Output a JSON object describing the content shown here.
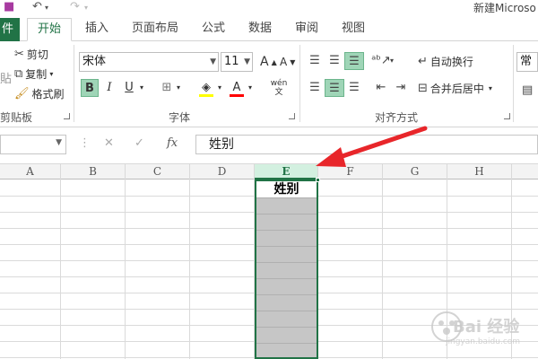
{
  "window": {
    "title": "新建Microso"
  },
  "tabs": {
    "file": "件",
    "items": [
      "开始",
      "插入",
      "页面布局",
      "公式",
      "数据",
      "审阅",
      "视图"
    ],
    "active": "开始"
  },
  "clipboard": {
    "cut": "剪切",
    "copy": "复制",
    "format_painter": "格式刷",
    "group_label": "剪贴板"
  },
  "font": {
    "name": "宋体",
    "size": "11",
    "bold": "B",
    "italic": "I",
    "underline": "U",
    "phonetic": "wén",
    "group_label": "字体"
  },
  "alignment": {
    "wrap_text": "自动换行",
    "merge_center": "合并后居中",
    "group_label": "对齐方式"
  },
  "number": {
    "format": "常规"
  },
  "formula_bar": {
    "fx": "fx",
    "value": "姓别"
  },
  "columns": [
    "A",
    "B",
    "C",
    "D",
    "E",
    "F",
    "G",
    "H"
  ],
  "selected_column": "E",
  "cells": {
    "E1": "姓别"
  },
  "colors": {
    "accent": "#217346",
    "selection_fill": "#c6c6c6",
    "header_selected": "#d3f0e0",
    "arrow": "#e8262a",
    "highlight_yellow": "#ffff00",
    "font_red": "#ff0000"
  },
  "icons": [
    "undo-icon",
    "redo-icon",
    "scissors-icon",
    "copy-icon",
    "paintbrush-icon",
    "bucket-icon",
    "font-color-icon",
    "borders-icon",
    "cancel-icon",
    "enter-icon"
  ],
  "watermark": {
    "text": "Bai 经验",
    "sub": "jingyan.baidu.com"
  }
}
